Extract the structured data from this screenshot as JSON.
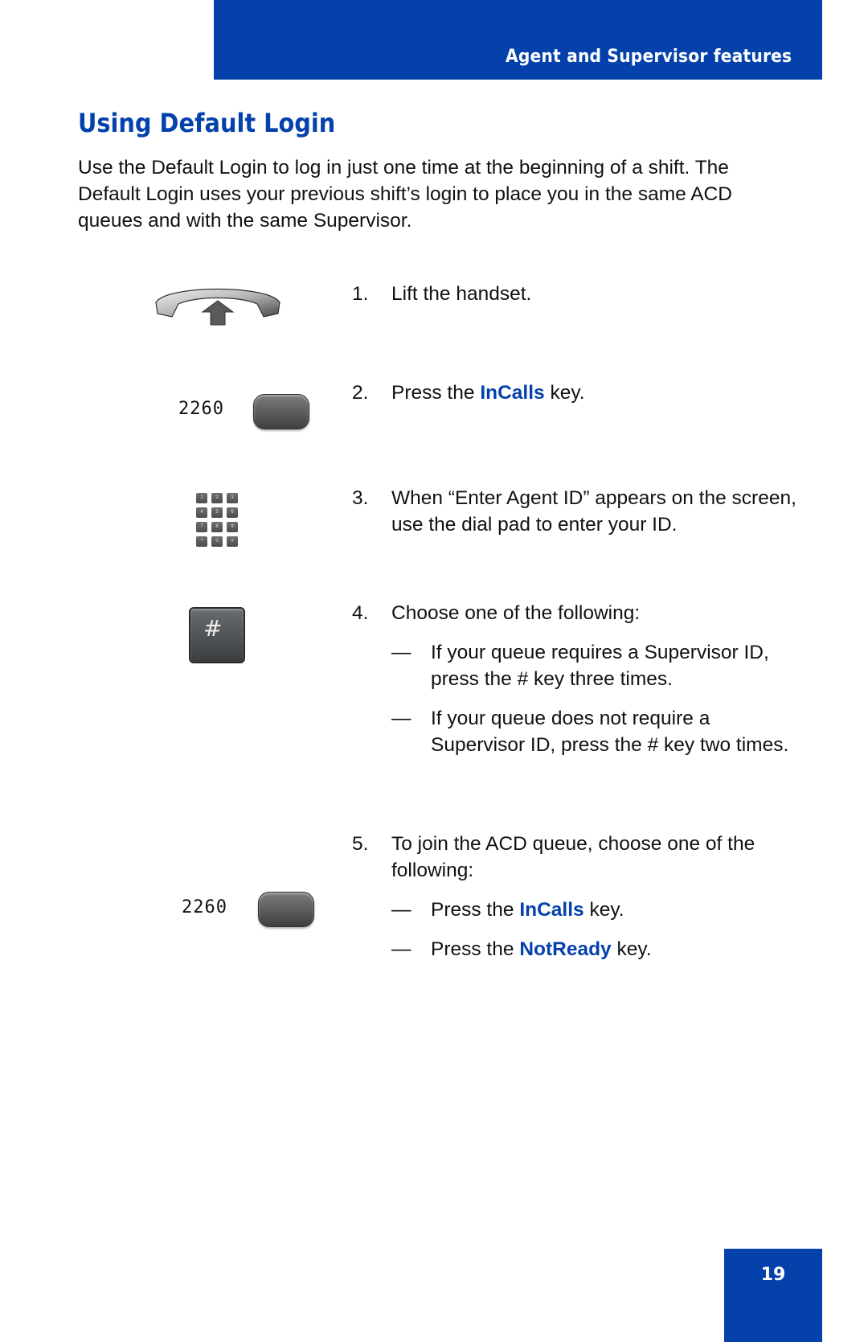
{
  "header": {
    "section_title": "Agent and Supervisor features"
  },
  "page": {
    "title": "Using Default Login",
    "intro": "Use the Default Login to log in just one time at the beginning of a shift. The Default Login uses your previous shift’s login to place you in the same ACD queues and with the same Supervisor.",
    "number": "19"
  },
  "colors": {
    "brand_blue": "#0441ab"
  },
  "icons": {
    "handset": "handset-lift-icon",
    "softkey_label": "2260",
    "keypad_keys": [
      "1",
      "2",
      "3",
      "4",
      "5",
      "6",
      "7",
      "8",
      "9",
      "*",
      "0",
      "#"
    ],
    "hash_key_label": "#"
  },
  "steps": [
    {
      "num": "1.",
      "text": "Lift the handset."
    },
    {
      "num": "2.",
      "pre": "Press the ",
      "key": "InCalls",
      "post": " key."
    },
    {
      "num": "3.",
      "text": "When “Enter Agent ID” appears on the screen, use the dial pad to enter your ID."
    },
    {
      "num": "4.",
      "text": "Choose one of the following:",
      "options": [
        {
          "dash": "—",
          "text": "If your queue requires a Supervisor ID, press the # key three times."
        },
        {
          "dash": "—",
          "text": "If your queue does not require a Supervisor ID, press the # key two times."
        }
      ]
    },
    {
      "num": "5.",
      "text": "To join the ACD queue, choose one of the following:",
      "options": [
        {
          "dash": "—",
          "pre": "Press the ",
          "key": "InCalls",
          "post": " key."
        },
        {
          "dash": "—",
          "pre": "Press the ",
          "key": "NotReady",
          "post": " key."
        }
      ]
    }
  ]
}
